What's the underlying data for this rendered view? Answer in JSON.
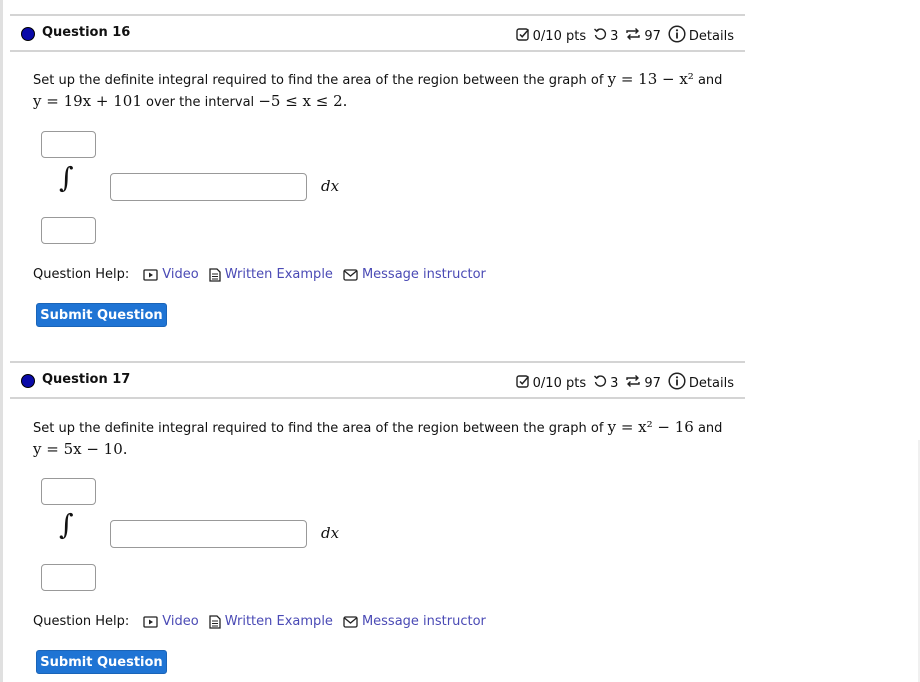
{
  "colors": {
    "accent": "#1f74d4",
    "link": "#4a4ab5",
    "status_dot": "#0a0aa8",
    "divider": "#d4d4d4"
  },
  "questions": [
    {
      "title": "Question 16",
      "status_icon": "filled-dot-icon",
      "score": "0/10 pts",
      "retries": "3",
      "attempts": "97",
      "details_label": "Details",
      "prompt_text_1": "Set up the definite integral required to find the area of the region between the graph of",
      "prompt_math_1": "y = 13 − x²",
      "prompt_text_2": "and",
      "prompt_math_2": "y = 19x + 101",
      "prompt_text_3": "over the interval",
      "prompt_math_3": "−5 ≤ x ≤ 2.",
      "integral_sign": "∫",
      "upper_limit_value": "",
      "lower_limit_value": "",
      "integrand_value": "",
      "differential": "dx",
      "help_label": "Question Help:",
      "help_links": [
        {
          "icon": "video-icon",
          "label": "Video"
        },
        {
          "icon": "document-icon",
          "label": "Written Example"
        },
        {
          "icon": "envelope-icon",
          "label": "Message instructor"
        }
      ],
      "submit_label": "Submit Question"
    },
    {
      "title": "Question 17",
      "status_icon": "filled-dot-icon",
      "score": "0/10 pts",
      "retries": "3",
      "attempts": "97",
      "details_label": "Details",
      "prompt_text_1": "Set up the definite integral required to find the area of the region between the graph of",
      "prompt_math_1": "y = x² − 16",
      "prompt_text_2": "and",
      "prompt_math_2": "y = 5x − 10.",
      "prompt_text_3": "",
      "prompt_math_3": "",
      "integral_sign": "∫",
      "upper_limit_value": "",
      "lower_limit_value": "",
      "integrand_value": "",
      "differential": "dx",
      "help_label": "Question Help:",
      "help_links": [
        {
          "icon": "video-icon",
          "label": "Video"
        },
        {
          "icon": "document-icon",
          "label": "Written Example"
        },
        {
          "icon": "envelope-icon",
          "label": "Message instructor"
        }
      ],
      "submit_label": "Submit Question"
    }
  ]
}
